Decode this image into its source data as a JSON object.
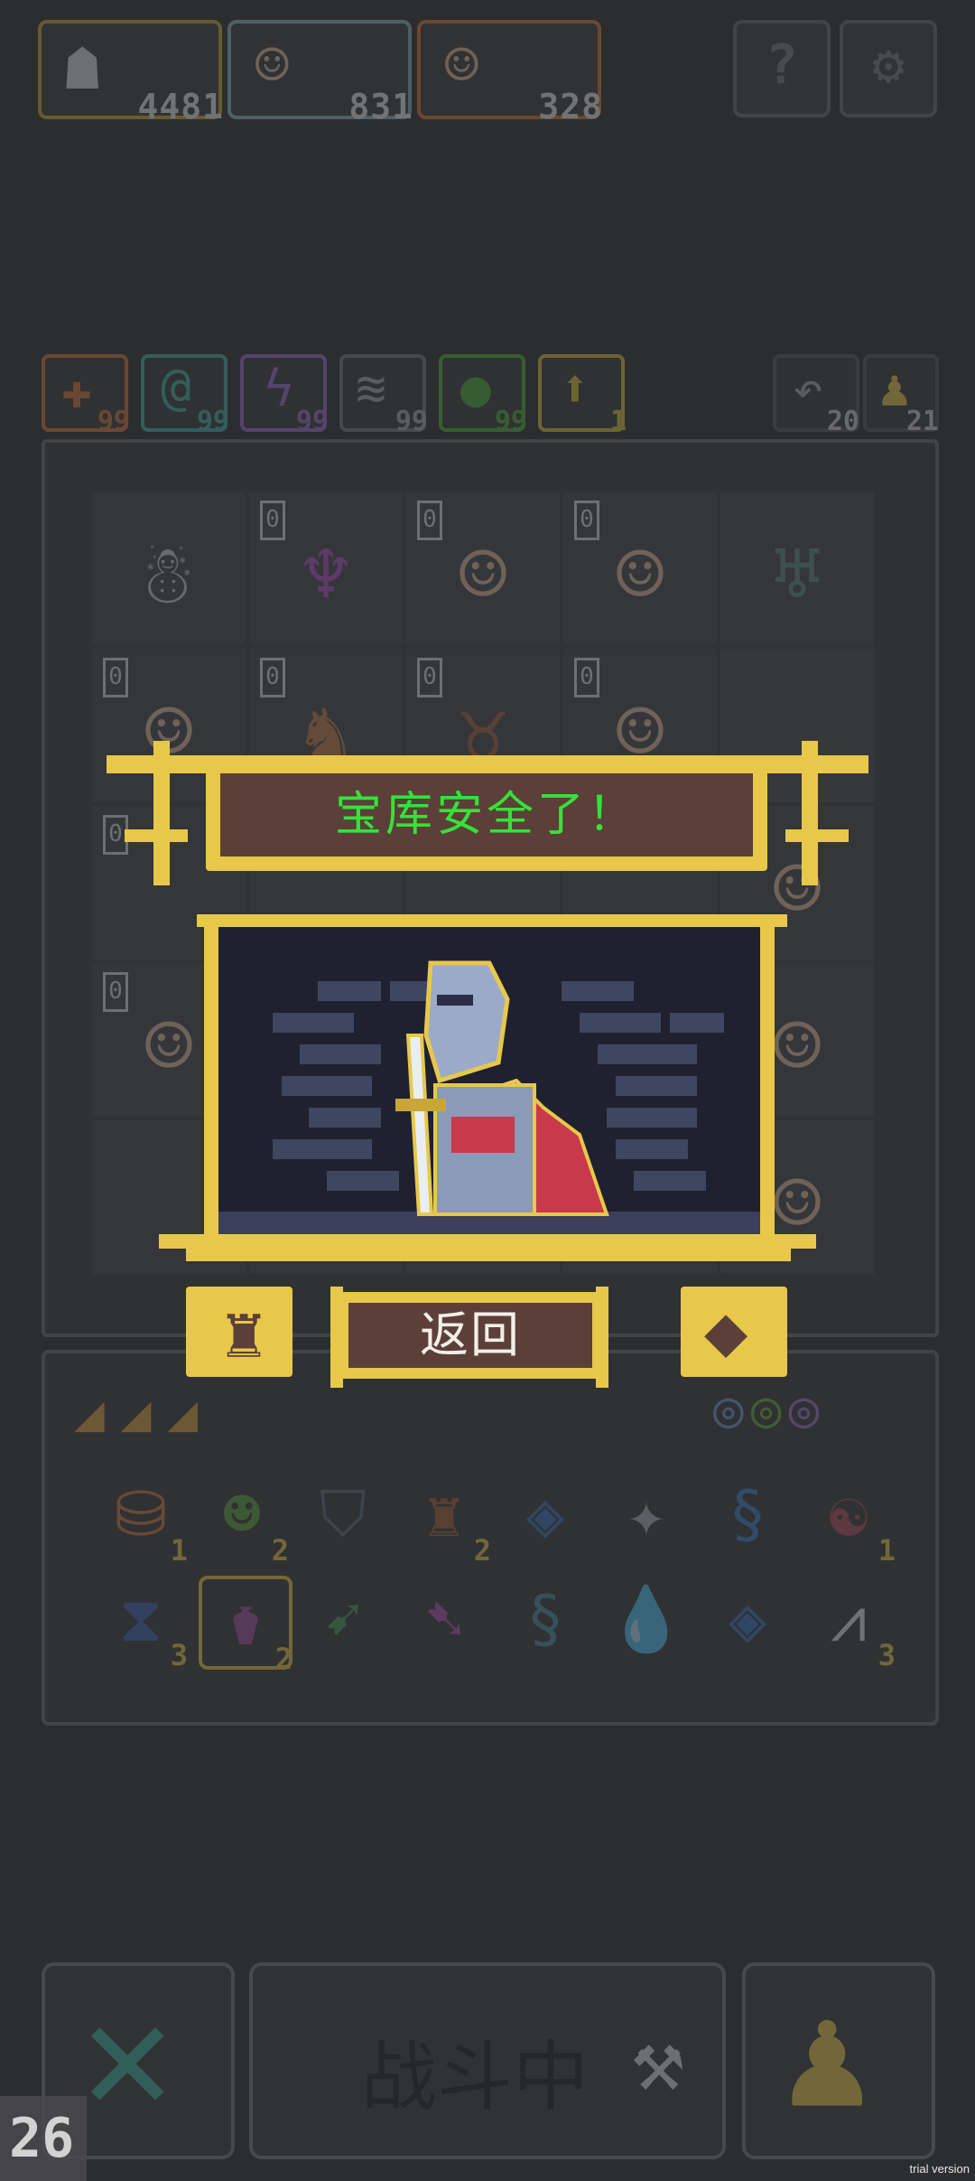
{
  "resources": [
    {
      "icon": "crowd-icon",
      "value": "4481"
    },
    {
      "icon": "elf-portrait-icon",
      "value": "831"
    },
    {
      "icon": "elf-portrait-icon",
      "value": "328"
    }
  ],
  "top_buttons": [
    {
      "icon": "help-icon",
      "label": "?"
    },
    {
      "icon": "settings-gear-icon",
      "label": "⚙"
    }
  ],
  "stats": [
    {
      "icon": "attack-plus-icon",
      "value": "99",
      "color": "#d4743a"
    },
    {
      "icon": "swirl-icon",
      "value": "99",
      "color": "#3fb0a8"
    },
    {
      "icon": "lightning-icon",
      "value": "99",
      "color": "#9a6ad0"
    },
    {
      "icon": "wings-icon",
      "value": "99",
      "color": "#a0a0a0"
    },
    {
      "icon": "green-blob-icon",
      "value": "99",
      "color": "#4caa3c"
    },
    {
      "icon": "up-arrow-icon",
      "value": "1",
      "color": "#d8c23a"
    }
  ],
  "side_stats": [
    {
      "icon": "return-icon",
      "value": "20"
    },
    {
      "icon": "pawn-icon",
      "value": "21"
    }
  ],
  "grid_badge": "0",
  "popup": {
    "title": "宝库安全了！",
    "back_label": "返回"
  },
  "inventory_counts": {
    "row1": [
      "1",
      "2",
      "",
      "2",
      "",
      "",
      "",
      "1"
    ],
    "row2": [
      "3",
      "2",
      "",
      "",
      "",
      "",
      "",
      "3"
    ]
  },
  "bottom": {
    "battle_label": "战斗中",
    "turn_counter": "26"
  },
  "watermark": "trial version"
}
